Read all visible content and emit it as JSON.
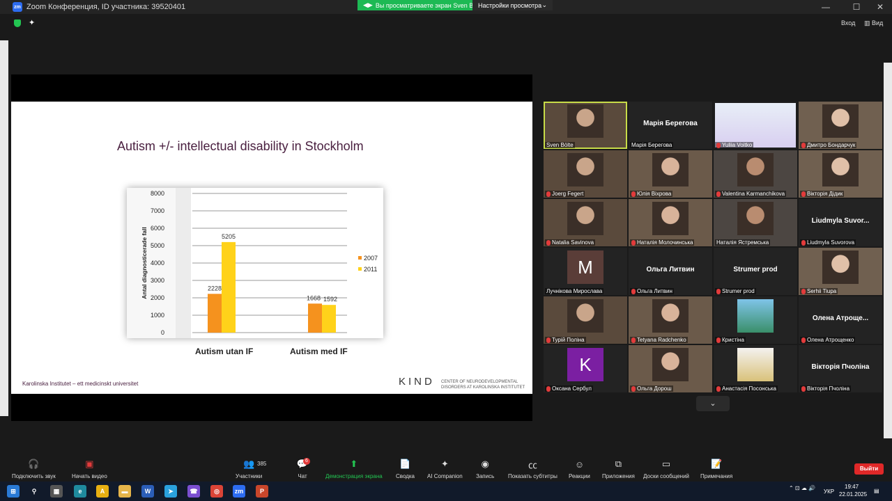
{
  "window": {
    "title": "Zoom Конференция, ID участника: 39520401",
    "share_banner": "Вы просматриваете экран Sven Bölte",
    "view_options": "Настройки просмотра",
    "minimize": "—",
    "maximize": "☐",
    "close": "✕"
  },
  "top_right": {
    "signin": "Вход",
    "view": "Вид"
  },
  "slide": {
    "title": "Autism +/- intellectual disability in Stockholm",
    "footer": "Karolinska Institutet – ett medicinskt universitet",
    "logo": "KIND",
    "logo_sub_1": "CENTER OF NEURODEVELOPMENTAL",
    "logo_sub_2": "DISORDERS AT KAROLINSKA INSTITUTET"
  },
  "chart_data": {
    "type": "bar",
    "title": "",
    "ylabel": "Antal diagnosticerade fall",
    "xlabel": "",
    "ylim": [
      0,
      8000
    ],
    "yticks": [
      "0",
      "1000",
      "2000",
      "3000",
      "4000",
      "5000",
      "6000",
      "7000",
      "8000"
    ],
    "categories": [
      "Autism utan IF",
      "Autism med IF"
    ],
    "series": [
      {
        "name": "2007",
        "values": [
          2228,
          1668
        ],
        "color": "#f5921e"
      },
      {
        "name": "2011",
        "values": [
          5205,
          1592
        ],
        "color": "#ffd21a"
      }
    ],
    "legend": "right",
    "grid": true
  },
  "participants": [
    {
      "name": "Sven Bölte",
      "center": "",
      "muted": false,
      "active": true,
      "kind": "video-kind"
    },
    {
      "name": "Марія Берегова",
      "center": "Марія Берегова",
      "muted": false,
      "kind": "name"
    },
    {
      "name": "Yuliia Voitko",
      "center": "",
      "muted": true,
      "kind": "poster"
    },
    {
      "name": "Дмитро Бондарчук",
      "center": "",
      "muted": true,
      "kind": "video"
    },
    {
      "name": "Joerg Fegert",
      "center": "",
      "muted": true,
      "kind": "video"
    },
    {
      "name": "Юлія Віхрова",
      "center": "",
      "muted": true,
      "kind": "video"
    },
    {
      "name": "Valentina Karmanchikova",
      "center": "",
      "muted": true,
      "kind": "video"
    },
    {
      "name": "Вікторія Дідик",
      "center": "",
      "muted": true,
      "kind": "video"
    },
    {
      "name": "Natalia Savinova",
      "center": "",
      "muted": true,
      "kind": "video"
    },
    {
      "name": "Наталія Молочинська",
      "center": "",
      "muted": true,
      "kind": "video"
    },
    {
      "name": "Наталія Ястремська",
      "center": "",
      "muted": false,
      "kind": "video"
    },
    {
      "name": "Liudmyla Suvorova",
      "center": "Liudmyla Suvor...",
      "muted": true,
      "kind": "name"
    },
    {
      "name": "Лучнікова Мирослава",
      "center": "",
      "muted": false,
      "kind": "letter",
      "letter": "M",
      "color": "#5a3d38"
    },
    {
      "name": "Ольга Литвин",
      "center": "Ольга Литвин",
      "muted": true,
      "kind": "name"
    },
    {
      "name": "Strumer prod",
      "center": "Strumer prod",
      "muted": true,
      "kind": "name"
    },
    {
      "name": "Serhii Tiupa",
      "center": "",
      "muted": true,
      "kind": "video"
    },
    {
      "name": "Турій Поліна",
      "center": "",
      "muted": true,
      "kind": "video"
    },
    {
      "name": "Tetyana Radchenko",
      "center": "",
      "muted": true,
      "kind": "video"
    },
    {
      "name": "Кристіна",
      "center": "",
      "muted": true,
      "kind": "photo"
    },
    {
      "name": "Олена Атрощенко",
      "center": "Олена Атроще...",
      "muted": true,
      "kind": "name"
    },
    {
      "name": "Оксана Сербул",
      "center": "",
      "muted": true,
      "kind": "letter",
      "letter": "K",
      "color": "#7b1fa2"
    },
    {
      "name": "Ольга Дорош",
      "center": "",
      "muted": true,
      "kind": "video"
    },
    {
      "name": "Анастасія Посонська",
      "center": "",
      "muted": true,
      "kind": "photo"
    },
    {
      "name": "Вікторія Пчоліна",
      "center": "Вікторія Пчоліна",
      "muted": true,
      "kind": "name"
    }
  ],
  "toolbar": {
    "audio": "Подключить звук",
    "video": "Начать видео",
    "participants": "Участники",
    "participants_count": "385",
    "chat": "Чат",
    "chat_badge": "6",
    "share": "Демонстрация экрана",
    "summary": "Сводка",
    "ai": "AI Companion",
    "record": "Запись",
    "captions": "Показать субтитры",
    "reactions": "Реакции",
    "apps": "Приложения",
    "whiteboards": "Доски сообщений",
    "notes": "Примечания",
    "leave": "Выйти"
  },
  "taskbar": {
    "lang": "УКР",
    "time": "19:47",
    "date": "22.01.2025"
  },
  "colors": {
    "share_green": "#1db954",
    "active_outline": "#c8dc48",
    "leave_red": "#e02828",
    "title_purple": "#4a2040"
  }
}
